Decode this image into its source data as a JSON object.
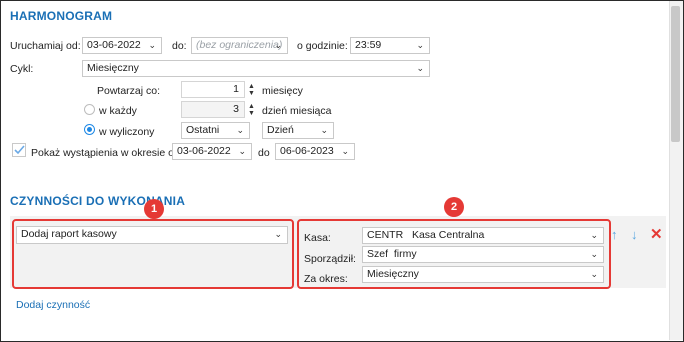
{
  "schedule": {
    "title": "HARMONOGRAM",
    "start_label": "Uruchamiaj od:",
    "start_date": "03-06-2022",
    "to_label": "do:",
    "end_placeholder": "(bez ograniczenia)",
    "time_label": "o godzinie:",
    "time": "23:59",
    "cycle_label": "Cykl:",
    "cycle": "Miesięczny",
    "repeat_label": "Powtarzaj co:",
    "repeat_value": "1",
    "repeat_unit": "miesięcy",
    "every_label": "w każdy",
    "every_value": "3",
    "every_unit": "dzień miesiąca",
    "calc_label": "w wyliczony",
    "calc_which": "Ostatni",
    "calc_unit": "Dzień",
    "show_label": "Pokaż wystąpienia w okresie od",
    "show_from": "03-06-2022",
    "show_to_label": "do",
    "show_to": "06-06-2023"
  },
  "actions": {
    "title": "CZYNNOŚCI DO WYKONANIA",
    "action_select": "Dodaj raport kasowy",
    "kasa_label": "Kasa:",
    "kasa_code": "CENTR",
    "kasa_name": "Kasa Centralna",
    "sporz_label": "Sporządził:",
    "sporz_value": "Szef  firmy",
    "okres_label": "Za okres:",
    "okres_value": "Miesięczny",
    "add_link": "Dodaj czynność",
    "badge1": "1",
    "badge2": "2"
  },
  "icons": {
    "chevron": "chevron-down-icon",
    "check": "checkmark-icon",
    "up": "arrow-up-icon",
    "down": "arrow-down-icon",
    "delete": "close-icon"
  },
  "colors": {
    "accent": "#1a6fb5",
    "highlight": "#e53935",
    "delete": "#e53935",
    "radio": "#1e88e5"
  }
}
